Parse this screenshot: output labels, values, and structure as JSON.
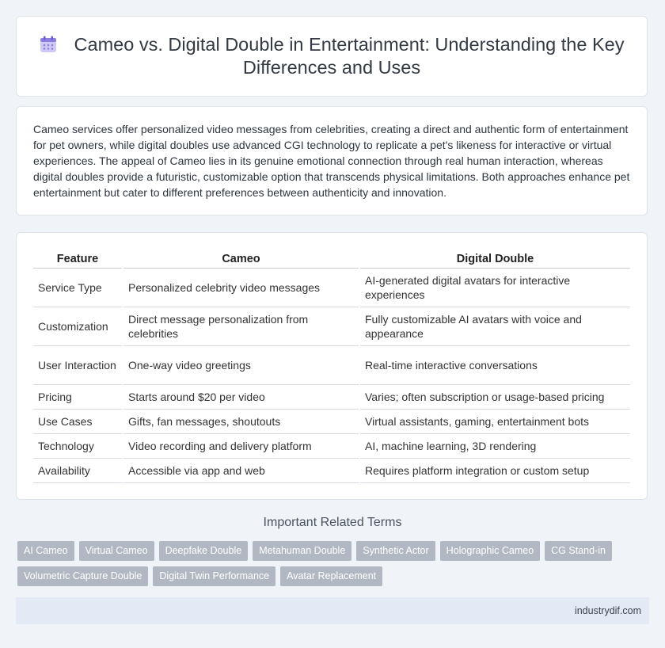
{
  "header": {
    "title": "Cameo vs. Digital Double in Entertainment: Understanding the Key Differences and Uses",
    "icon": "calendar-icon"
  },
  "intro": {
    "text": "Cameo services offer personalized video messages from celebrities, creating a direct and authentic form of entertainment for pet owners, while digital doubles use advanced CGI technology to replicate a pet's likeness for interactive or virtual experiences. The appeal of Cameo lies in its genuine emotional connection through real human interaction, whereas digital doubles provide a futuristic, customizable option that transcends physical limitations. Both approaches enhance pet entertainment but cater to different preferences between authenticity and innovation."
  },
  "table": {
    "headers": [
      "Feature",
      "Cameo",
      "Digital Double"
    ],
    "rows": [
      [
        "Service Type",
        "Personalized celebrity video messages",
        "AI-generated digital avatars for interactive experiences"
      ],
      [
        "Customization",
        "Direct message personalization from celebrities",
        "Fully customizable AI avatars with voice and appearance"
      ],
      [
        "User Interaction",
        "One-way video greetings",
        "Real-time interactive conversations"
      ],
      [
        "Pricing",
        "Starts around $20 per video",
        "Varies; often subscription or usage-based pricing"
      ],
      [
        "Use Cases",
        "Gifts, fan messages, shoutouts",
        "Virtual assistants, gaming, entertainment bots"
      ],
      [
        "Technology",
        "Video recording and delivery platform",
        "AI, machine learning, 3D rendering"
      ],
      [
        "Availability",
        "Accessible via app and web",
        "Requires platform integration or custom setup"
      ]
    ]
  },
  "related": {
    "heading": "Important Related Terms",
    "tags": [
      "AI Cameo",
      "Virtual Cameo",
      "Deepfake Double",
      "Metahuman Double",
      "Synthetic Actor",
      "Holographic Cameo",
      "CG Stand-in",
      "Volumetric Capture Double",
      "Digital Twin Performance",
      "Avatar Replacement"
    ]
  },
  "footer": {
    "site": "industrydif.com"
  },
  "colors": {
    "background": "#f0f3f8",
    "tag": "#b2b8c3",
    "footer": "#e3e9f5",
    "icon": "#8a7fe0"
  }
}
